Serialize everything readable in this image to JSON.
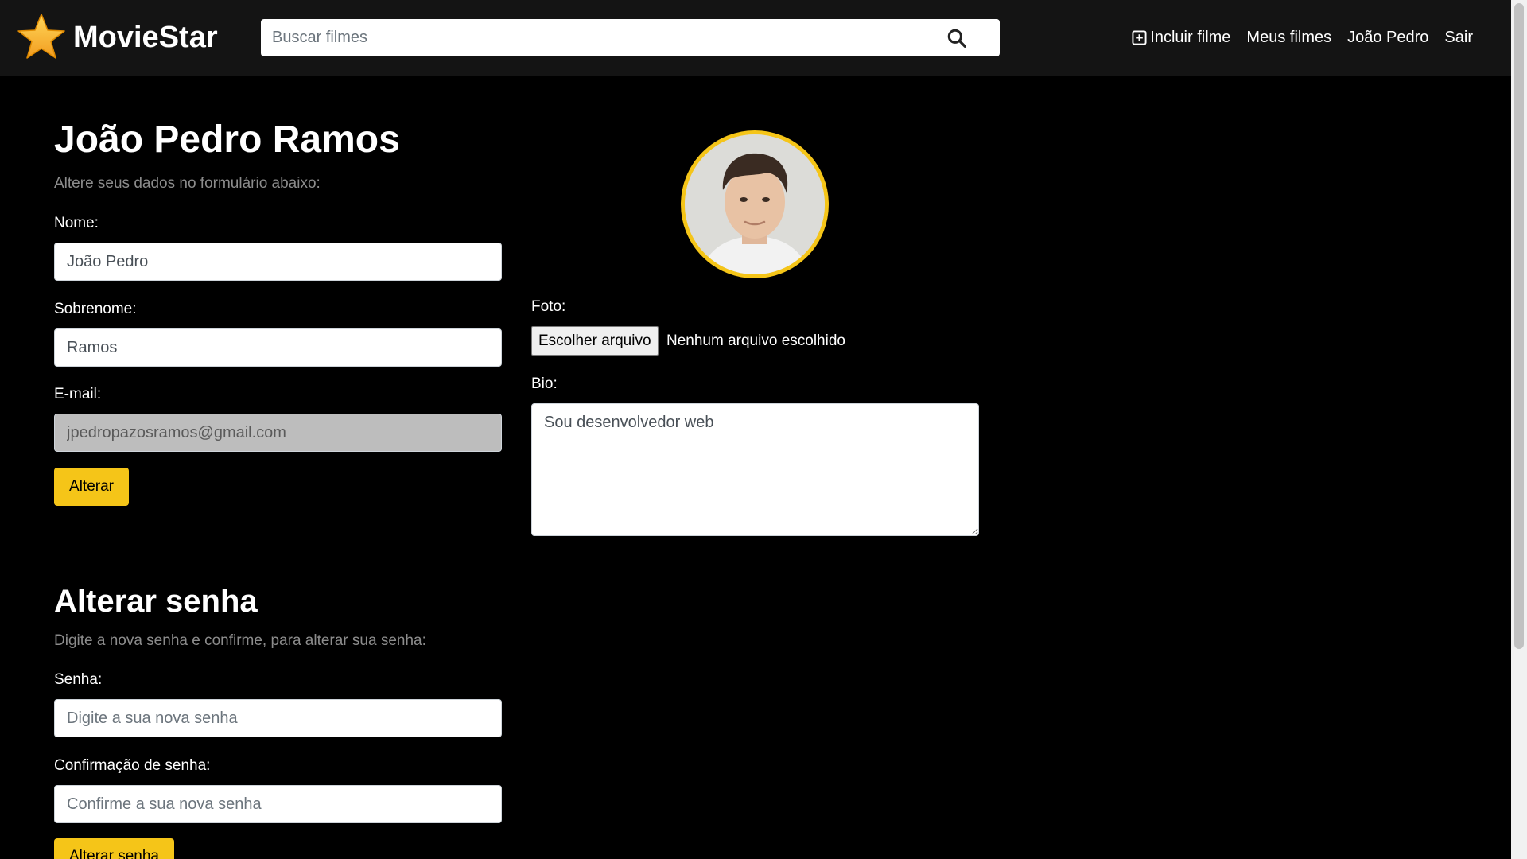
{
  "header": {
    "brand": "MovieStar",
    "search_placeholder": "Buscar filmes",
    "nav": {
      "add_movie": "Incluir filme",
      "my_movies": "Meus filmes",
      "user": "João Pedro",
      "logout": "Sair"
    }
  },
  "profile": {
    "title": "João Pedro Ramos",
    "subtitle": "Altere seus dados no formulário abaixo:",
    "name_label": "Nome:",
    "name_value": "João Pedro",
    "lastname_label": "Sobrenome:",
    "lastname_value": "Ramos",
    "email_label": "E-mail:",
    "email_value": "jpedropazosramos@gmail.com",
    "submit_label": "Alterar",
    "photo_label": "Foto:",
    "file_button": "Escolher arquivo",
    "file_status": "Nenhum arquivo escolhido",
    "bio_label": "Bio:",
    "bio_value": "Sou desenvolvedor web"
  },
  "password": {
    "title": "Alterar senha",
    "subtitle": "Digite a nova senha e confirme, para alterar sua senha:",
    "password_label": "Senha:",
    "password_placeholder": "Digite a sua nova senha",
    "confirm_label": "Confirmação de senha:",
    "confirm_placeholder": "Confirme a sua nova senha",
    "submit_label": "Alterar senha"
  },
  "colors": {
    "accent": "#f5c518",
    "header_bg": "#141414",
    "page_bg": "#000000"
  }
}
